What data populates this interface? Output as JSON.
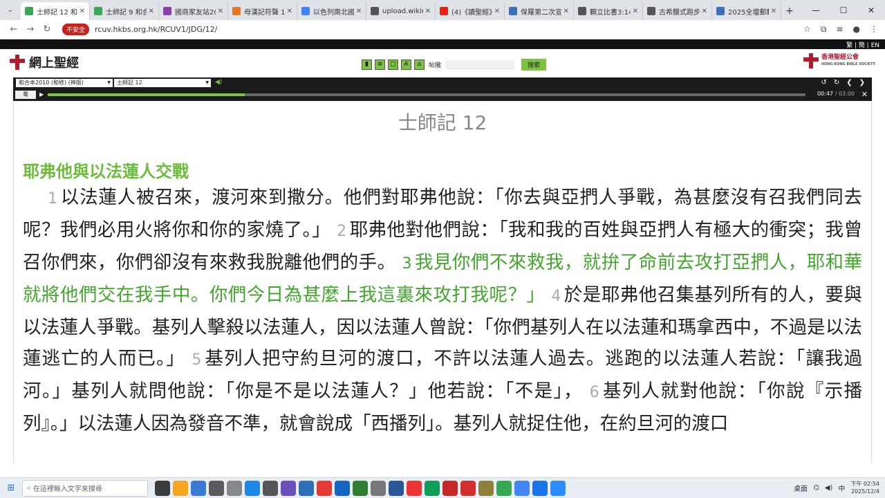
{
  "browser": {
    "tabs": [
      {
        "title": "士師記 12 和合",
        "active": true,
        "color": "#3aa655"
      },
      {
        "title": "士師記 9 和合",
        "active": false,
        "color": "#3aa655"
      },
      {
        "title": "國商家友站20",
        "active": false,
        "color": "#8b3fa8"
      },
      {
        "title": "母漢記符聲 1 V",
        "active": false,
        "color": "#e07a2a"
      },
      {
        "title": "以色列南北國",
        "active": false,
        "color": "#4285f4"
      },
      {
        "title": "upload.wikim",
        "active": false,
        "color": "#555555"
      },
      {
        "title": "(4)《讀聖經》",
        "active": false,
        "color": "#e62117"
      },
      {
        "title": "保羅第二次宣",
        "active": false,
        "color": "#3b6fb6"
      },
      {
        "title": "顆立比書3:14",
        "active": false,
        "color": "#555555"
      },
      {
        "title": "古希臘式跑步",
        "active": false,
        "color": "#555555"
      },
      {
        "title": "2025全壇郵動",
        "active": false,
        "color": "#3b6fb6"
      }
    ],
    "new_tab": "+",
    "insecure_label": "不安全",
    "url": "rcuv.hkbs.org.hk/RCUV1/JDG/12/"
  },
  "site": {
    "lang_switch": "繁 | 簡 | EN",
    "logo_text": "網上聖經",
    "search_label": "帖撒",
    "search_placeholder": "",
    "search_button": "搜索",
    "publisher": "香港聖經公會",
    "publisher_en": "HONG KONG BIBLE SOCIETY"
  },
  "player": {
    "version_select": "和合本2010 (和修) (神版)",
    "chapter_select": "士師記 12",
    "tone_label": "粵",
    "current_time": "00:47",
    "duration": "/ 03:00",
    "progress_fraction": 0.26
  },
  "passage": {
    "chapter_title": "士師記 12",
    "section_title": "耶弗他與以法蓮人交戰",
    "verses": [
      {
        "n": "1",
        "text": "以法蓮人被召來，渡河來到撒分。他們對耶弗他說：「你去與亞捫人爭戰，為甚麼沒有召我們同去呢？我們必用火將你和你的家燒了。」",
        "highlight": false
      },
      {
        "n": "2",
        "text": "耶弗他對他們說：「我和我的百姓與亞捫人有極大的衝突；我曾召你們來，你們卻沒有來救我脫離他們的手。",
        "highlight": false
      },
      {
        "n": "3",
        "text": "我見你們不來救我，就拚了命前去攻打亞捫人，耶和華就將他們交在我手中。你們今日為甚麼上我這裏來攻打我呢？」",
        "highlight": true
      },
      {
        "n": "4",
        "text": "於是耶弗他召集基列所有的人，要與以法蓮人爭戰。基列人擊殺以法蓮人，因以法蓮人曾說：「你們基列人在以法蓮和瑪拿西中，不過是以法蓮逃亡的人而已。」",
        "highlight": false
      },
      {
        "n": "5",
        "text": "基列人把守約旦河的渡口，不許以法蓮人過去。逃跑的以法蓮人若說：「讓我過河。」基列人就問他說：「你是不是以法蓮人？」他若說：「不是」，",
        "highlight": false
      },
      {
        "n": "6",
        "text": "基列人就對他說：「你說『示播列』。」以法蓮人因為發音不準，就會說成「西播列」。基列人就捉住他，在約旦河的渡口",
        "highlight": false
      }
    ]
  },
  "taskbar": {
    "search_placeholder": "在這裡輸入文字來搜尋",
    "desktop_label": "桌面",
    "ime": "中",
    "time": "下午 02:54",
    "date": "2025/12/4"
  }
}
